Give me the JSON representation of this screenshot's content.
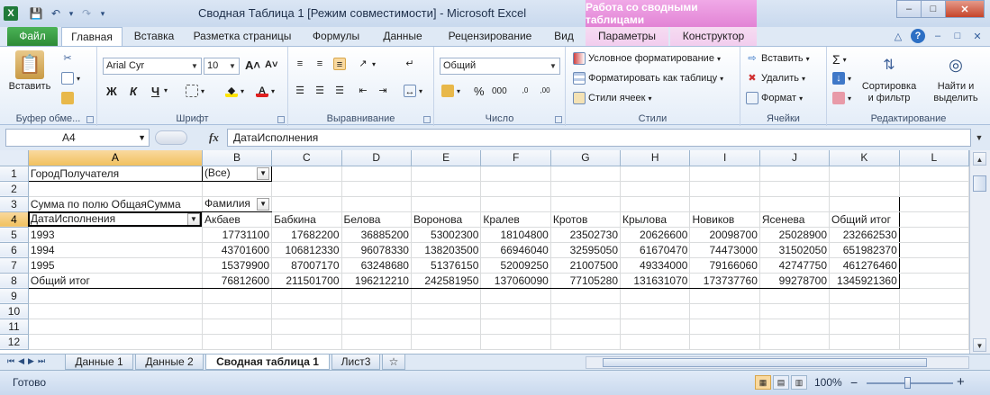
{
  "window": {
    "title": "Сводная Таблица 1  [Режим совместимости]  -  Microsoft Excel",
    "context_tab_header": "Работа со сводными таблицами",
    "controls": [
      "–",
      "□",
      "✕"
    ]
  },
  "quick_access": {
    "save": "💾",
    "undo": "↶",
    "redo": "↷",
    "customize": "▾"
  },
  "tabs": [
    {
      "label": "Файл"
    },
    {
      "label": "Главная"
    },
    {
      "label": "Вставка"
    },
    {
      "label": "Разметка страницы"
    },
    {
      "label": "Формулы"
    },
    {
      "label": "Данные"
    },
    {
      "label": "Рецензирование"
    },
    {
      "label": "Вид"
    },
    {
      "label": "Параметры"
    },
    {
      "label": "Конструктор"
    }
  ],
  "ribbon": {
    "clipboard": {
      "label": "Буфер обме...",
      "paste": "Вставить"
    },
    "font": {
      "label": "Шрифт",
      "name": "Arial Cyr",
      "size": "10",
      "bold": "Ж",
      "italic": "К",
      "underline": "Ч",
      "grow": "A˄",
      "shrink": "A˅"
    },
    "alignment": {
      "label": "Выравнивание"
    },
    "number": {
      "label": "Число",
      "format": "Общий",
      "percent": "%",
      "comma": "000"
    },
    "styles": {
      "label": "Стили",
      "conditional": "Условное форматирование",
      "as_table": "Форматировать как таблицу",
      "cell_styles": "Стили ячеек"
    },
    "cells": {
      "label": "Ячейки",
      "insert": "Вставить",
      "delete": "Удалить",
      "format": "Формат"
    },
    "editing": {
      "label": "Редактирование",
      "sort_l1": "Сортировка",
      "sort_l2": "и фильтр",
      "find_l1": "Найти и",
      "find_l2": "выделить"
    }
  },
  "formula_bar": {
    "name_box": "A4",
    "fx": "fx",
    "value": "ДатаИсполнения"
  },
  "sheet": {
    "columns": [
      "A",
      "B",
      "C",
      "D",
      "E",
      "F",
      "G",
      "H",
      "I",
      "J",
      "K",
      "L"
    ],
    "rows": {
      "r1": {
        "a": "ГородПолучателя",
        "b": "(Все)"
      },
      "r3": {
        "a": "Сумма по полю ОбщаяСумма",
        "b": "Фамилия"
      },
      "r4": [
        "ДатаИсполнения",
        "Акбаев",
        "Бабкина",
        "Белова",
        "Воронова",
        "Кралев",
        "Кротов",
        "Крылова",
        "Новиков",
        "Ясенева",
        "Общий итог"
      ],
      "r5": [
        "1993",
        "17731100",
        "17682200",
        "36885200",
        "53002300",
        "18104800",
        "23502730",
        "20626600",
        "20098700",
        "25028900",
        "232662530"
      ],
      "r6": [
        "1994",
        "43701600",
        "106812330",
        "96078330",
        "138203500",
        "66946040",
        "32595050",
        "61670470",
        "74473000",
        "31502050",
        "651982370"
      ],
      "r7": [
        "1995",
        "15379900",
        "87007170",
        "63248680",
        "51376150",
        "52009250",
        "21007500",
        "49334000",
        "79166060",
        "42747750",
        "461276460"
      ],
      "r8": [
        "Общий итог",
        "76812600",
        "211501700",
        "196212210",
        "242581950",
        "137060090",
        "77105280",
        "131631070",
        "173737760",
        "99278700",
        "1345921360"
      ]
    }
  },
  "sheet_tabs": [
    "Данные 1",
    "Данные 2",
    "Сводная таблица 1",
    "Лист3"
  ],
  "status": {
    "ready": "Готово",
    "zoom": "100%",
    "zoom_out": "−",
    "zoom_in": "+"
  }
}
